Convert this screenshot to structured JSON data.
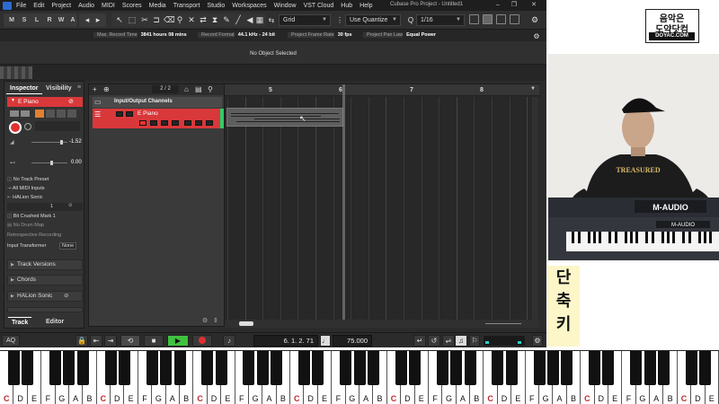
{
  "window": {
    "title": "Cubase Pro Project - Untitled1",
    "menu": [
      "File",
      "Edit",
      "Project",
      "Audio",
      "MIDI",
      "Scores",
      "Media",
      "Transport",
      "Studio",
      "Workspaces",
      "Window",
      "VST Cloud",
      "Hub",
      "Help"
    ]
  },
  "toolbar": {
    "mode_buttons": [
      "M",
      "S",
      "L",
      "R",
      "W",
      "A"
    ],
    "snap_mode": "Grid",
    "quantize_mode": "Use Quantize",
    "quantize_value": "1/16"
  },
  "infobar": {
    "items": [
      {
        "label": "Max. Record Time",
        "value": "3841 hours 08 mins"
      },
      {
        "label": "Record Format",
        "value": "44.1 kHz - 24 bit"
      },
      {
        "label": "Project Frame Rate",
        "value": "30 fps"
      },
      {
        "label": "Project Pan Law",
        "value": "Equal Power"
      }
    ]
  },
  "selection": {
    "text": "No Object Selected"
  },
  "inspector": {
    "tabs": [
      "Inspector",
      "Visibility"
    ],
    "track_name": "E Piano",
    "volume": "-1.52",
    "pan": "0.00",
    "input": "No Track Preset",
    "midi_input": "All MIDI Inputs",
    "output": "HALion Sonic",
    "channel": "1",
    "program": "Bit Crushed Mark 1",
    "drum_map": "No Drum Map",
    "retro_record": "Retrospective Recording",
    "input_transformer_label": "Input Transformer",
    "input_transformer_value": "None",
    "sections": [
      "Track Versions",
      "Chords",
      "HALion Sonic"
    ],
    "bottom_tabs": [
      "Track",
      "Editor"
    ]
  },
  "tracklist": {
    "counter": "2 / 2",
    "folder_name": "Input/Output Channels",
    "track_name": "E Piano"
  },
  "ruler": {
    "bars": [
      "5",
      "6",
      "7",
      "8"
    ]
  },
  "transport": {
    "left_label": "AQ",
    "position": "6. 1. 2. 71",
    "tempo": "75.000"
  },
  "overlay": {
    "logo_line1": "음악은",
    "logo_line2": "도약닷컴",
    "logo_line3": "DOYAC.COM",
    "caption": [
      "단",
      "축",
      "키"
    ]
  },
  "piano": {
    "white_keys": [
      "C",
      "D",
      "E",
      "F",
      "G",
      "A",
      "B",
      "C",
      "D",
      "E",
      "F",
      "G",
      "A",
      "B",
      "C",
      "D",
      "E",
      "F",
      "G",
      "A",
      "B",
      "C",
      "D",
      "E",
      "F",
      "G",
      "A",
      "B",
      "C",
      "D",
      "E",
      "F",
      "G",
      "A",
      "B",
      "C",
      "D",
      "E",
      "F",
      "G",
      "A",
      "B",
      "C",
      "D",
      "E",
      "F",
      "G",
      "A",
      "B",
      "C",
      "D",
      "E"
    ]
  },
  "colors": {
    "track_red": "#d9383a",
    "play_green": "#3fc23f",
    "record_red": "#e03030",
    "caption_bg": "#fcf6c8",
    "key_c_label": "#c0282e"
  }
}
